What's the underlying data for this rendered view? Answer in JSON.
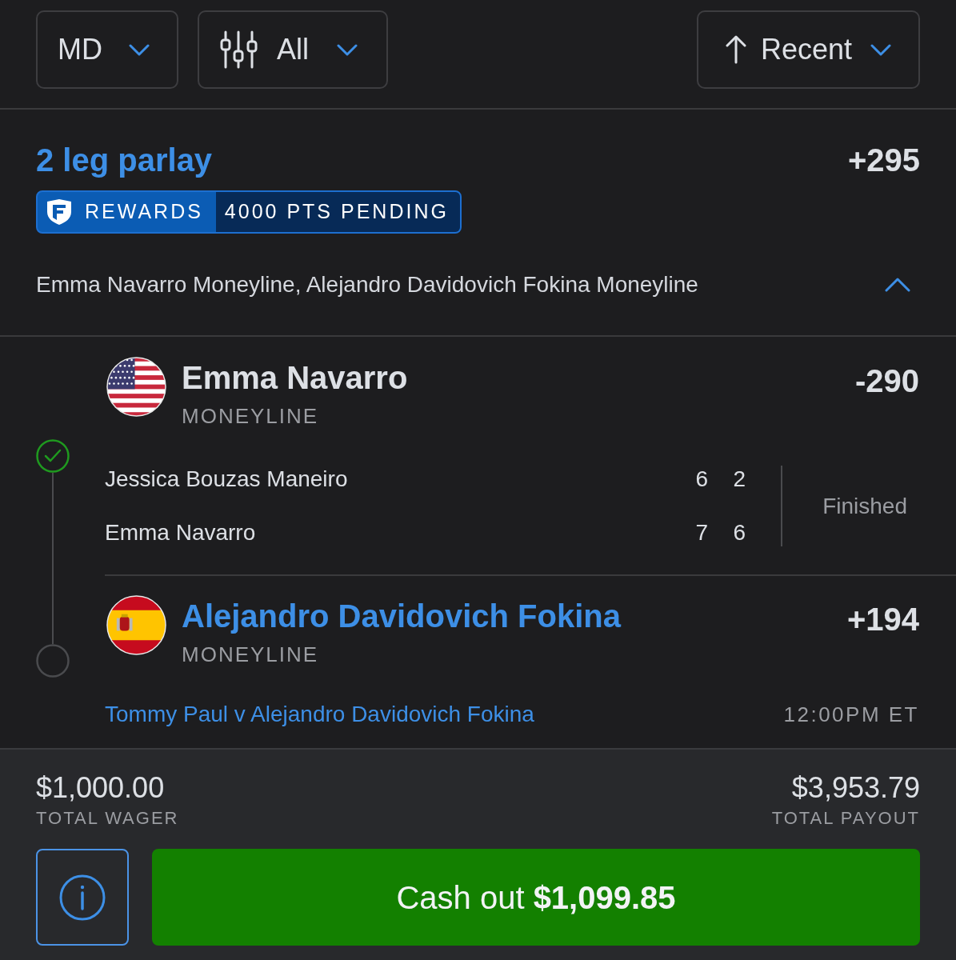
{
  "toolbar": {
    "region": {
      "label": "MD"
    },
    "filter": {
      "label": "All"
    },
    "sort": {
      "label": "Recent"
    }
  },
  "bet": {
    "title": "2 leg parlay",
    "odds": "+295",
    "rewards": {
      "label": "REWARDS",
      "points": "4000 PTS PENDING"
    },
    "summary": "Emma Navarro Moneyline, Alejandro Davidovich Fokina Moneyline",
    "expanded": true
  },
  "legs": [
    {
      "kind": "us",
      "selection": "Emma Navarro",
      "market": "MONEYLINE",
      "odds": "-290",
      "won": true,
      "scoreboard": {
        "rows": [
          {
            "player": "Jessica Bouzas Maneiro",
            "sets": [
              "6",
              "2"
            ]
          },
          {
            "player": "Emma Navarro",
            "sets": [
              "7",
              "6"
            ]
          }
        ],
        "state": "Finished"
      }
    },
    {
      "kind": "es",
      "selection": "Alejandro Davidovich Fokina",
      "market": "MONEYLINE",
      "odds": "+194",
      "won": false,
      "event": {
        "name": "Tommy Paul v Alejandro Davidovich Fokina",
        "time": "12:00PM ET"
      }
    }
  ],
  "footer": {
    "wager": {
      "amount": "$1,000.00",
      "label": "TOTAL WAGER"
    },
    "payout": {
      "amount": "$3,953.79",
      "label": "TOTAL PAYOUT"
    },
    "cash_out": "Cash out **$1,099.85**"
  }
}
